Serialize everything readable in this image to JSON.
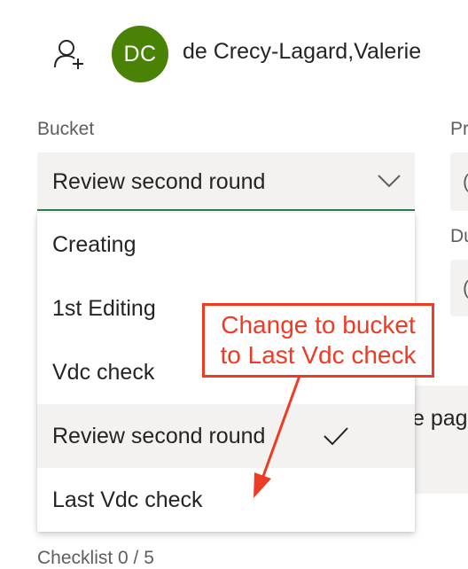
{
  "assignee": {
    "initials": "DC",
    "name": "de Crecy-Lagard,Valerie",
    "avatar_color": "#498205",
    "icon": "assign-person-icon"
  },
  "bucket": {
    "label": "Bucket",
    "value": "Review second round",
    "options": [
      {
        "label": "Creating",
        "selected": false
      },
      {
        "label": "1st Editing",
        "selected": false
      },
      {
        "label": "Vdc check",
        "selected": false
      },
      {
        "label": "Review second round",
        "selected": true
      },
      {
        "label": "Last Vdc check",
        "selected": false
      }
    ]
  },
  "side_fields": {
    "priority_label_partial": "Pr",
    "due_label_partial": "Du",
    "priority_value_partial": "(",
    "due_value_partial": "(",
    "background_text_partial": "e pag"
  },
  "checklist": {
    "label": "Checklist 0 / 5"
  },
  "annotation": {
    "line1": "Change to bucket",
    "line2": "to Last Vdc check",
    "color": "#ee3b24"
  },
  "colors": {
    "accent_underline": "#2e7d51",
    "field_bg": "#f3f2f1"
  }
}
